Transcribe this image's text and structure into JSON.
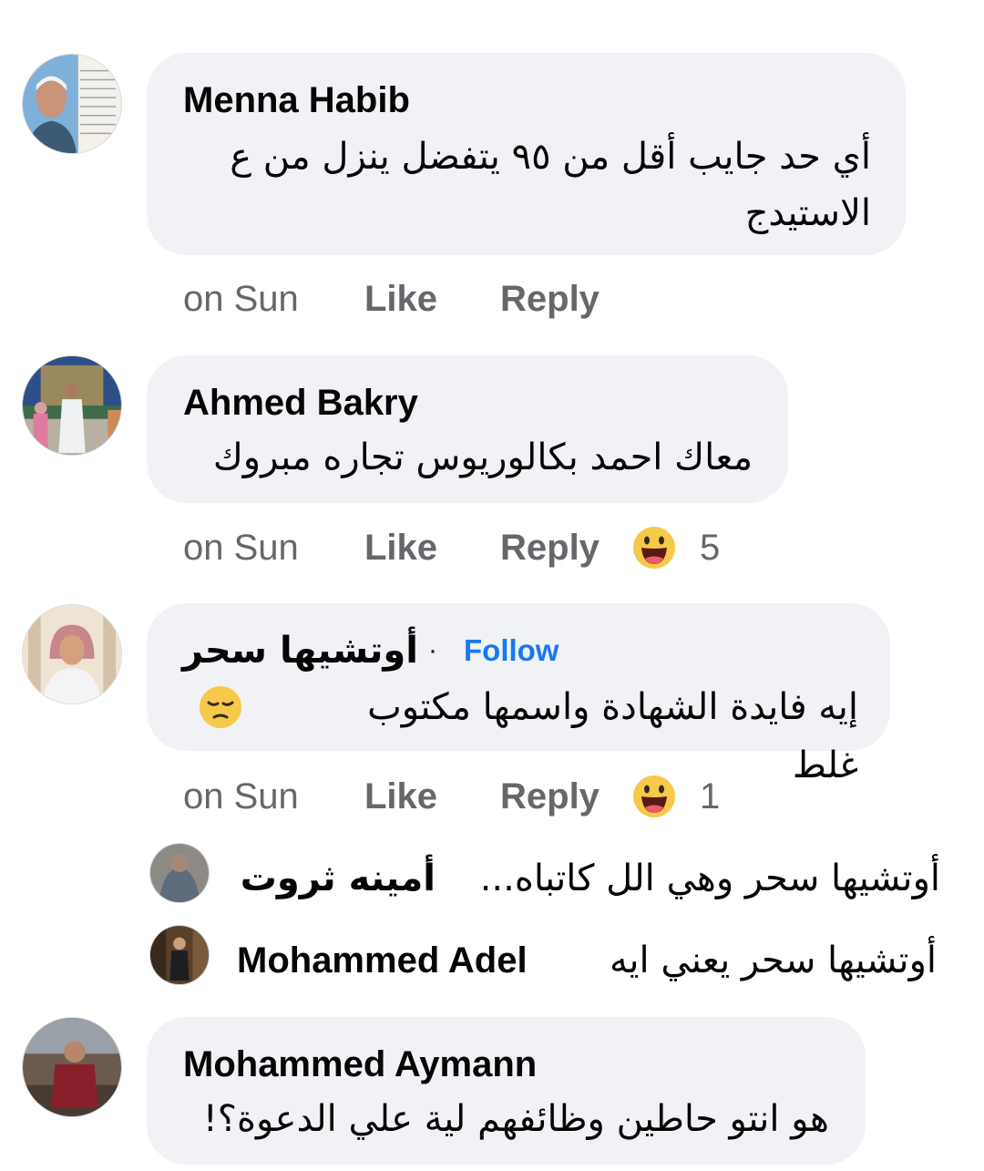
{
  "comments": [
    {
      "author": "Menna Habib",
      "text_line1": "أي حد جايب أقل من ٩٥ يتفضل ينزل من ع",
      "text_line2": "الاستيدج",
      "time": "on Sun",
      "like_label": "Like",
      "reply_label": "Reply",
      "avatar_icon": "person-avatar-icon"
    },
    {
      "author": "Ahmed Bakry",
      "text": "معاك احمد بكالوريوس تجاره مبروك",
      "time": "on Sun",
      "like_label": "Like",
      "reply_label": "Reply",
      "reaction_icon": "haha-emoji-icon",
      "reaction_count": "5"
    },
    {
      "author": "أوتشيها سحر",
      "separator": "·",
      "follow_label": "Follow",
      "text": "إيه فايدة الشهادة واسمها مكتوب غلط",
      "text_emoji_icon": "pensive-face-emoji-icon",
      "time": "on Sun",
      "like_label": "Like",
      "reply_label": "Reply",
      "reaction_icon": "haha-emoji-icon",
      "reaction_count": "1",
      "replies": [
        {
          "author": "أمينه ثروت",
          "text": "أوتشيها سحر وهي الل كاتباه..."
        },
        {
          "author": "Mohammed Adel",
          "text": "أوتشيها سحر يعني ايه"
        }
      ]
    },
    {
      "author": "Mohammed Aymann",
      "text": "هو انتو حاطين وظائفهم لية علي الدعوة؟!"
    }
  ],
  "colors": {
    "bubble": "#f0f2f5",
    "secondary_text": "#65676b",
    "link_blue": "#1877f2"
  }
}
